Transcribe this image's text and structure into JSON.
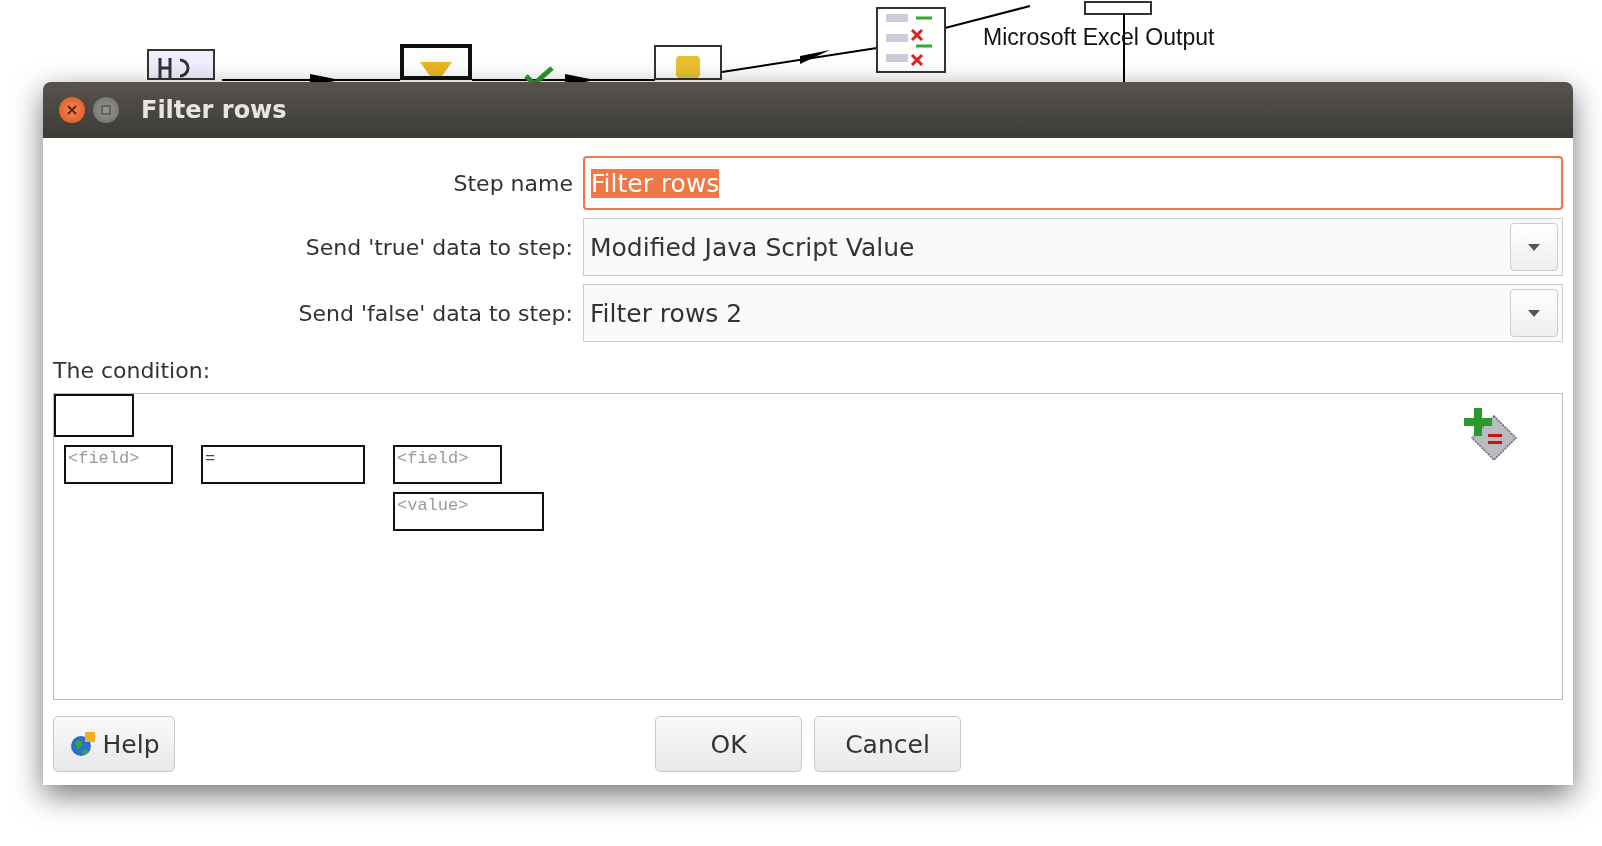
{
  "canvas": {
    "label": "Microsoft Excel Output"
  },
  "window": {
    "title": "Filter rows"
  },
  "form": [
    {
      "kind": "text",
      "label": "Step name",
      "value": "Filter rows",
      "focused": true,
      "text_selected": true
    },
    {
      "kind": "combo",
      "label": "Send 'true' data to step:",
      "value": "Modified Java Script Value",
      "focused": false,
      "text_selected": false
    },
    {
      "kind": "combo",
      "label": "Send 'false' data to step:",
      "value": "Filter rows 2",
      "focused": false,
      "text_selected": false
    }
  ],
  "condition": {
    "label": "The condition:",
    "left": "<field>",
    "function": "=",
    "right_field": "<field>",
    "right_value": "<value>"
  },
  "buttons": {
    "help": "Help",
    "ok": "OK",
    "cancel": "Cancel"
  }
}
